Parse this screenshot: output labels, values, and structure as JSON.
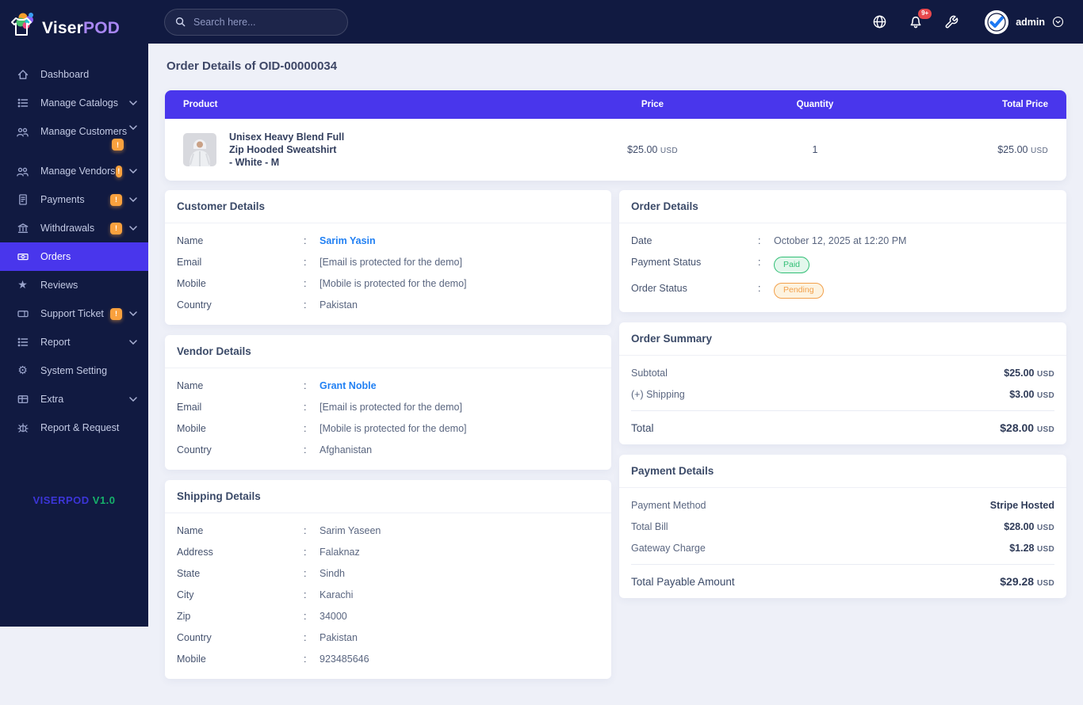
{
  "ui": {
    "colon": ":"
  },
  "colors": {
    "sidebar_bg": "#111a41",
    "accent_purple": "#4936ec",
    "badge_orange": "#f9a13e",
    "notif_red": "#e8484d",
    "link_blue": "#2180f3",
    "paid_green": "#2fbe74",
    "pending_orange": "#f2a04b",
    "main_bg": "#eef0f8"
  },
  "brand": {
    "name_a": "Viser",
    "name_b": "POD",
    "version_name": "VISERPOD",
    "version_num": "V1.0"
  },
  "topbar": {
    "search_placeholder": "Search here...",
    "notif_badge": "9+",
    "username": "admin"
  },
  "sidebar": {
    "items": [
      {
        "label": "Dashboard"
      },
      {
        "label": "Manage Catalogs"
      },
      {
        "label": "Manage Customers",
        "badge": "!"
      },
      {
        "label": "Manage Vendors",
        "badge": "!"
      },
      {
        "label": "Payments",
        "badge": "!"
      },
      {
        "label": "Withdrawals",
        "badge": "!"
      },
      {
        "label": "Orders"
      },
      {
        "label": "Reviews"
      },
      {
        "label": "Support Ticket",
        "badge": "!"
      },
      {
        "label": "Report"
      },
      {
        "label": "System Setting"
      },
      {
        "label": "Extra"
      },
      {
        "label": "Report & Request"
      }
    ]
  },
  "page": {
    "title": "Order Details of OID-00000034"
  },
  "order_table": {
    "col_product": "Product",
    "col_price": "Price",
    "col_qty": "Quantity",
    "col_total": "Total Price",
    "product_line1": "Unisex Heavy Blend Full",
    "product_line2": "Zip Hooded Sweatshirt",
    "product_line3": "- White - M",
    "price": "$25.00",
    "price_cur": "USD",
    "qty": "1",
    "total": "$25.00",
    "total_cur": "USD"
  },
  "customer": {
    "title": "Customer Details",
    "name_label": "Name",
    "name_value": "Sarim Yasin",
    "email_label": "Email",
    "email_value": "[Email is protected for the demo]",
    "mobile_label": "Mobile",
    "mobile_value": "[Mobile is protected for the demo]",
    "country_label": "Country",
    "country_value": "Pakistan"
  },
  "vendor": {
    "title": "Vendor Details",
    "name_label": "Name",
    "name_value": "Grant Noble",
    "email_label": "Email",
    "email_value": "[Email is protected for the demo]",
    "mobile_label": "Mobile",
    "mobile_value": "[Mobile is protected for the demo]",
    "country_label": "Country",
    "country_value": "Afghanistan"
  },
  "shipping": {
    "title": "Shipping Details",
    "name_label": "Name",
    "name_value": "Sarim Yaseen",
    "address_label": "Address",
    "address_value": "Falaknaz",
    "state_label": "State",
    "state_value": "Sindh",
    "city_label": "City",
    "city_value": "Karachi",
    "zip_label": "Zip",
    "zip_value": "34000",
    "country_label": "Country",
    "country_value": "Pakistan",
    "mobile_label": "Mobile",
    "mobile_value": "923485646"
  },
  "order_info": {
    "title": "Order Details",
    "date_label": "Date",
    "date_value": "October 12, 2025 at 12:20 PM",
    "pay_status_label": "Payment Status",
    "pay_status": "Paid",
    "order_status_label": "Order Status",
    "order_status": "Pending"
  },
  "summary": {
    "title": "Order Summary",
    "subtotal_label": "Subtotal",
    "subtotal": "$25.00",
    "subtotal_cur": "USD",
    "shipping_label": "(+) Shipping",
    "shipping": "$3.00",
    "shipping_cur": "USD",
    "total_label": "Total",
    "total": "$28.00",
    "total_cur": "USD"
  },
  "payment": {
    "title": "Payment Details",
    "method_label": "Payment Method",
    "method": "Stripe Hosted",
    "bill_label": "Total Bill",
    "bill": "$28.00",
    "bill_cur": "USD",
    "gateway_label": "Gateway Charge",
    "gateway": "$1.28",
    "gateway_cur": "USD",
    "payable_label": "Total Payable Amount",
    "payable": "$29.28",
    "payable_cur": "USD"
  }
}
